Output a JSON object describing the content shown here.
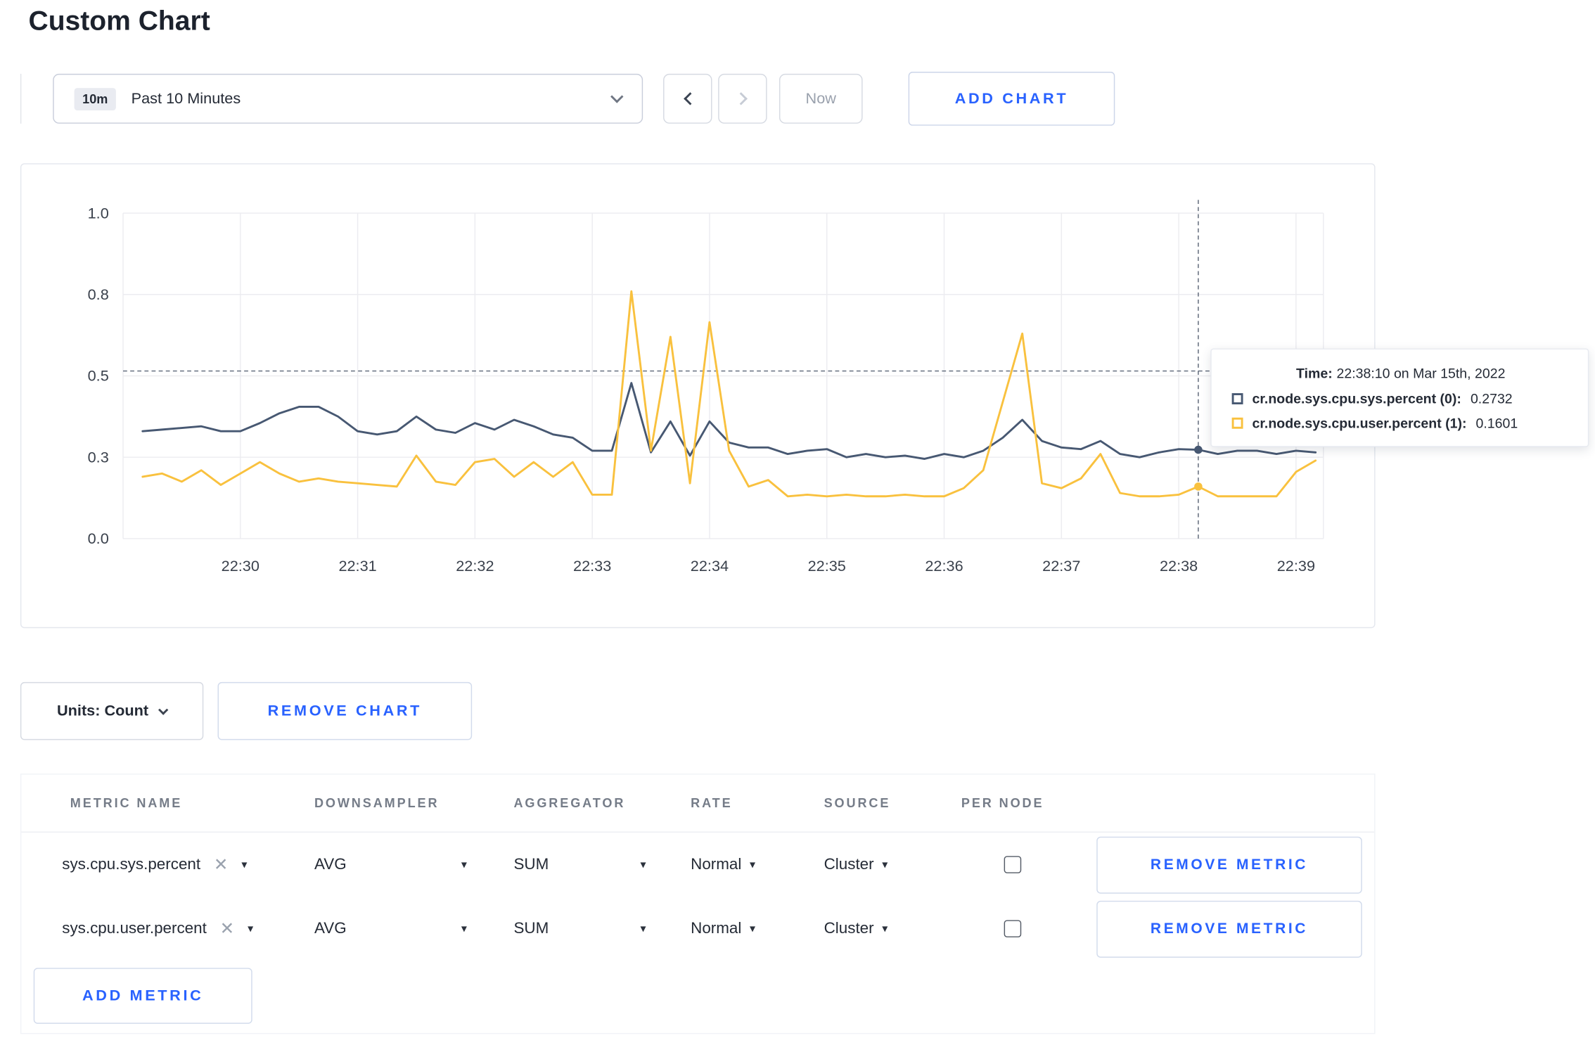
{
  "page": {
    "title": "Custom Chart"
  },
  "colors": {
    "accent_blue": "#2962ff",
    "series_sys": "#475872",
    "series_user": "#f9c13e"
  },
  "toolbar": {
    "time_badge": "10m",
    "time_label": "Past 10 Minutes",
    "now_label": "Now",
    "add_chart_label": "ADD CHART"
  },
  "chart_card": {
    "units_label": "Units: Count",
    "remove_chart_label": "REMOVE CHART"
  },
  "chart_data": {
    "type": "line",
    "title": "",
    "xlabel": "",
    "ylabel": "",
    "ylim": [
      0,
      1.0
    ],
    "grid": true,
    "y_ticks": [
      {
        "v": 0,
        "label": "0.0"
      },
      {
        "v": 0.25,
        "label": "0.3"
      },
      {
        "v": 0.5,
        "label": "0.5"
      },
      {
        "v": 0.75,
        "label": "0.8"
      },
      {
        "v": 1.0,
        "label": "1.0"
      }
    ],
    "x_ticks": [
      "22:30",
      "22:31",
      "22:32",
      "22:33",
      "22:34",
      "22:35",
      "22:36",
      "22:37",
      "22:38",
      "22:39"
    ],
    "x_tick_seconds": [
      50,
      110,
      170,
      230,
      290,
      350,
      410,
      470,
      530,
      590
    ],
    "x_domain_seconds": [
      -10,
      604
    ],
    "series": [
      {
        "name": "cr.node.sys.cpu.sys.percent",
        "color": "#475872",
        "start_second": 0,
        "step_seconds": 10,
        "values": [
          0.33,
          0.335,
          0.34,
          0.345,
          0.33,
          0.33,
          0.355,
          0.385,
          0.405,
          0.405,
          0.375,
          0.33,
          0.32,
          0.33,
          0.375,
          0.335,
          0.325,
          0.355,
          0.335,
          0.365,
          0.345,
          0.32,
          0.31,
          0.27,
          0.27,
          0.478,
          0.265,
          0.36,
          0.255,
          0.36,
          0.295,
          0.28,
          0.28,
          0.26,
          0.27,
          0.275,
          0.25,
          0.26,
          0.25,
          0.255,
          0.245,
          0.26,
          0.25,
          0.27,
          0.31,
          0.365,
          0.3,
          0.28,
          0.275,
          0.3,
          0.26,
          0.25,
          0.265,
          0.275,
          0.273,
          0.26,
          0.27,
          0.27,
          0.26,
          0.27,
          0.265
        ]
      },
      {
        "name": "cr.node.sys.cpu.user.percent",
        "color": "#f9c13e",
        "start_second": 0,
        "step_seconds": 10,
        "values": [
          0.19,
          0.2,
          0.175,
          0.21,
          0.165,
          0.2,
          0.235,
          0.2,
          0.175,
          0.185,
          0.175,
          0.17,
          0.165,
          0.16,
          0.255,
          0.175,
          0.165,
          0.235,
          0.245,
          0.19,
          0.235,
          0.19,
          0.235,
          0.135,
          0.135,
          0.76,
          0.27,
          0.62,
          0.17,
          0.665,
          0.27,
          0.16,
          0.18,
          0.13,
          0.135,
          0.13,
          0.135,
          0.13,
          0.13,
          0.135,
          0.13,
          0.13,
          0.155,
          0.21,
          0.42,
          0.63,
          0.17,
          0.155,
          0.185,
          0.26,
          0.14,
          0.13,
          0.13,
          0.135,
          0.16,
          0.13,
          0.13,
          0.13,
          0.13,
          0.205,
          0.24
        ]
      }
    ],
    "crosshair": {
      "x_second": 540,
      "hline_value": 0.515
    },
    "tooltip": {
      "time_label": "Time:",
      "time_value": "22:38:10 on Mar 15th, 2022",
      "rows": [
        {
          "label": "cr.node.sys.cpu.sys.percent (0):",
          "value": "0.2732"
        },
        {
          "label": "cr.node.sys.cpu.user.percent (1):",
          "value": "0.1601"
        }
      ]
    }
  },
  "metrics_table": {
    "headers": [
      "METRIC NAME",
      "DOWNSAMPLER",
      "AGGREGATOR",
      "RATE",
      "SOURCE",
      "PER NODE"
    ],
    "rows": [
      {
        "metric": "sys.cpu.sys.percent",
        "downsampler": "AVG",
        "aggregator": "SUM",
        "rate": "Normal",
        "source": "Cluster",
        "per_node": false,
        "remove_label": "REMOVE METRIC"
      },
      {
        "metric": "sys.cpu.user.percent",
        "downsampler": "AVG",
        "aggregator": "SUM",
        "rate": "Normal",
        "source": "Cluster",
        "per_node": false,
        "remove_label": "REMOVE METRIC"
      }
    ],
    "add_metric_label": "ADD METRIC"
  }
}
